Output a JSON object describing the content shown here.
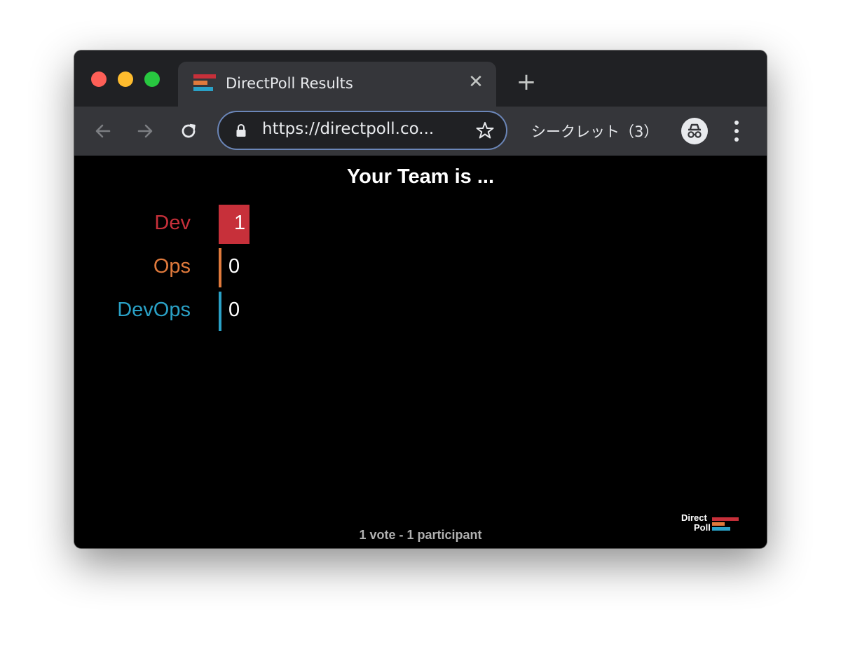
{
  "browser": {
    "tab_title": "DirectPoll Results",
    "url": "https://directpoll.co...",
    "incognito_label": "シークレット（3）"
  },
  "poll": {
    "title": "Your Team is ...",
    "options": [
      {
        "label": "Dev",
        "votes": 1,
        "color": "#c7303a"
      },
      {
        "label": "Ops",
        "votes": 0,
        "color": "#e07a3c"
      },
      {
        "label": "DevOps",
        "votes": 0,
        "color": "#2aa1c6"
      }
    ],
    "footer": "1 vote - 1 participant"
  },
  "logo": {
    "line1": "Direct",
    "line2": "Poll"
  },
  "icons": {
    "back": "arrow-left-icon",
    "forward": "arrow-right-icon",
    "reload": "reload-icon",
    "lock": "lock-icon",
    "bookmark": "star-icon",
    "incognito": "incognito-icon",
    "menu": "kebab-menu-icon",
    "close_tab": "close-icon",
    "new_tab": "plus-icon"
  },
  "colors": {
    "brand_red": "#c7303a",
    "brand_orange": "#e07a3c",
    "brand_blue": "#2aa1c6"
  }
}
